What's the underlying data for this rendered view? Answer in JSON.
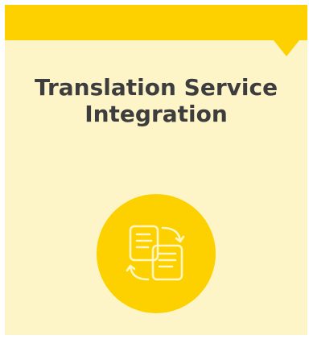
{
  "card": {
    "title_line1": "Translation Service",
    "title_line2": "Integration",
    "icon": "translation-documents-icon",
    "colors": {
      "accent": "#fdd000",
      "background": "#fdf5c8",
      "title_text": "#3d3d3d",
      "icon_stroke": "#fff6c2"
    }
  }
}
